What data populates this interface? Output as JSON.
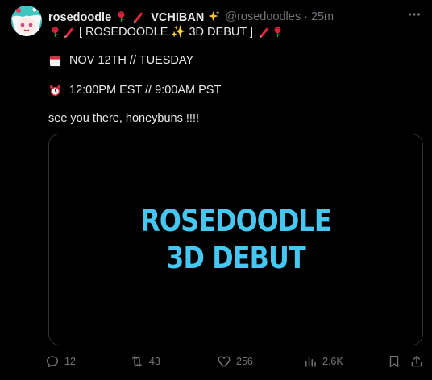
{
  "author": {
    "display_name_prefix": "rosedoodle",
    "display_name_suffix": "VCHIBAN",
    "handle": "@rosedoodles",
    "separator": "·",
    "time": "25m"
  },
  "tweet": {
    "title_line": "[ ROSEDOODLE ✨ 3D DEBUT ]",
    "date_line": "NOV 12TH // TUESDAY",
    "time_line": "12:00PM EST // 9:00AM PST",
    "closing_line": "see you there, honeybuns !!!!"
  },
  "media": {
    "line1": "ROSEDOODLE",
    "line2": "3D DEBUT",
    "text_color": "#45c7f2"
  },
  "actions": {
    "replies": "12",
    "retweets": "43",
    "likes": "256",
    "views": "2.6K"
  },
  "icons": {
    "rose": "rose-icon",
    "crayon": "crayon-icon",
    "sparkles": "sparkles-icon",
    "calendar": "calendar-icon",
    "alarm": "alarm-clock-icon"
  },
  "colors": {
    "background": "#000000",
    "text": "#e7e9ea",
    "muted": "#71767b",
    "border": "#2f3336",
    "accent": "#45c7f2"
  }
}
